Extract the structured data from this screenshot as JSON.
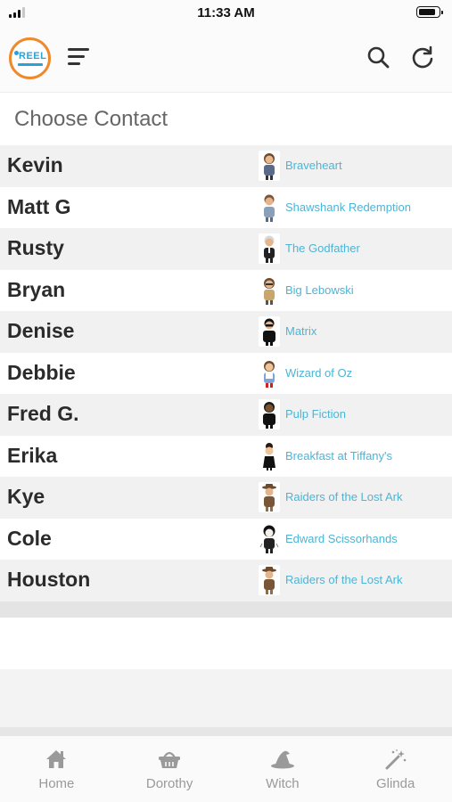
{
  "status_bar": {
    "time": "11:33 AM"
  },
  "header": {
    "logo_text": "REEL",
    "icons": {
      "menu": "menu-icon",
      "search": "search-icon",
      "refresh": "refresh-icon"
    }
  },
  "page": {
    "title": "Choose Contact"
  },
  "colors": {
    "accent": "#4bb5d6",
    "logo_ring": "#f0892a",
    "text": "#2b2b2b"
  },
  "contacts": [
    {
      "name": "Kevin",
      "movie": "Braveheart",
      "avatar": "braveheart-avatar"
    },
    {
      "name": "Matt G",
      "movie": "Shawshank Redemption",
      "avatar": "shawshank-avatar"
    },
    {
      "name": "Rusty",
      "movie": "The Godfather",
      "avatar": "godfather-avatar"
    },
    {
      "name": "Bryan",
      "movie": "Big Lebowski",
      "avatar": "lebowski-avatar"
    },
    {
      "name": "Denise",
      "movie": "Matrix",
      "avatar": "matrix-avatar"
    },
    {
      "name": "Debbie",
      "movie": "Wizard of Oz",
      "avatar": "wizard-of-oz-avatar"
    },
    {
      "name": "Fred G.",
      "movie": "Pulp Fiction",
      "avatar": "pulp-fiction-avatar"
    },
    {
      "name": "Erika",
      "movie": "Breakfast at Tiffany's",
      "avatar": "tiffanys-avatar"
    },
    {
      "name": "Kye",
      "movie": "Raiders of the Lost Ark",
      "avatar": "raiders-avatar"
    },
    {
      "name": "Cole",
      "movie": "Edward Scissorhands",
      "avatar": "scissorhands-avatar"
    },
    {
      "name": "Houston",
      "movie": "Raiders of the Lost Ark",
      "avatar": "raiders-avatar"
    }
  ],
  "tabs": [
    {
      "label": "Home",
      "icon": "home-icon"
    },
    {
      "label": "Dorothy",
      "icon": "basket-icon"
    },
    {
      "label": "Witch",
      "icon": "witch-hat-icon"
    },
    {
      "label": "Glinda",
      "icon": "magic-wand-icon"
    }
  ]
}
